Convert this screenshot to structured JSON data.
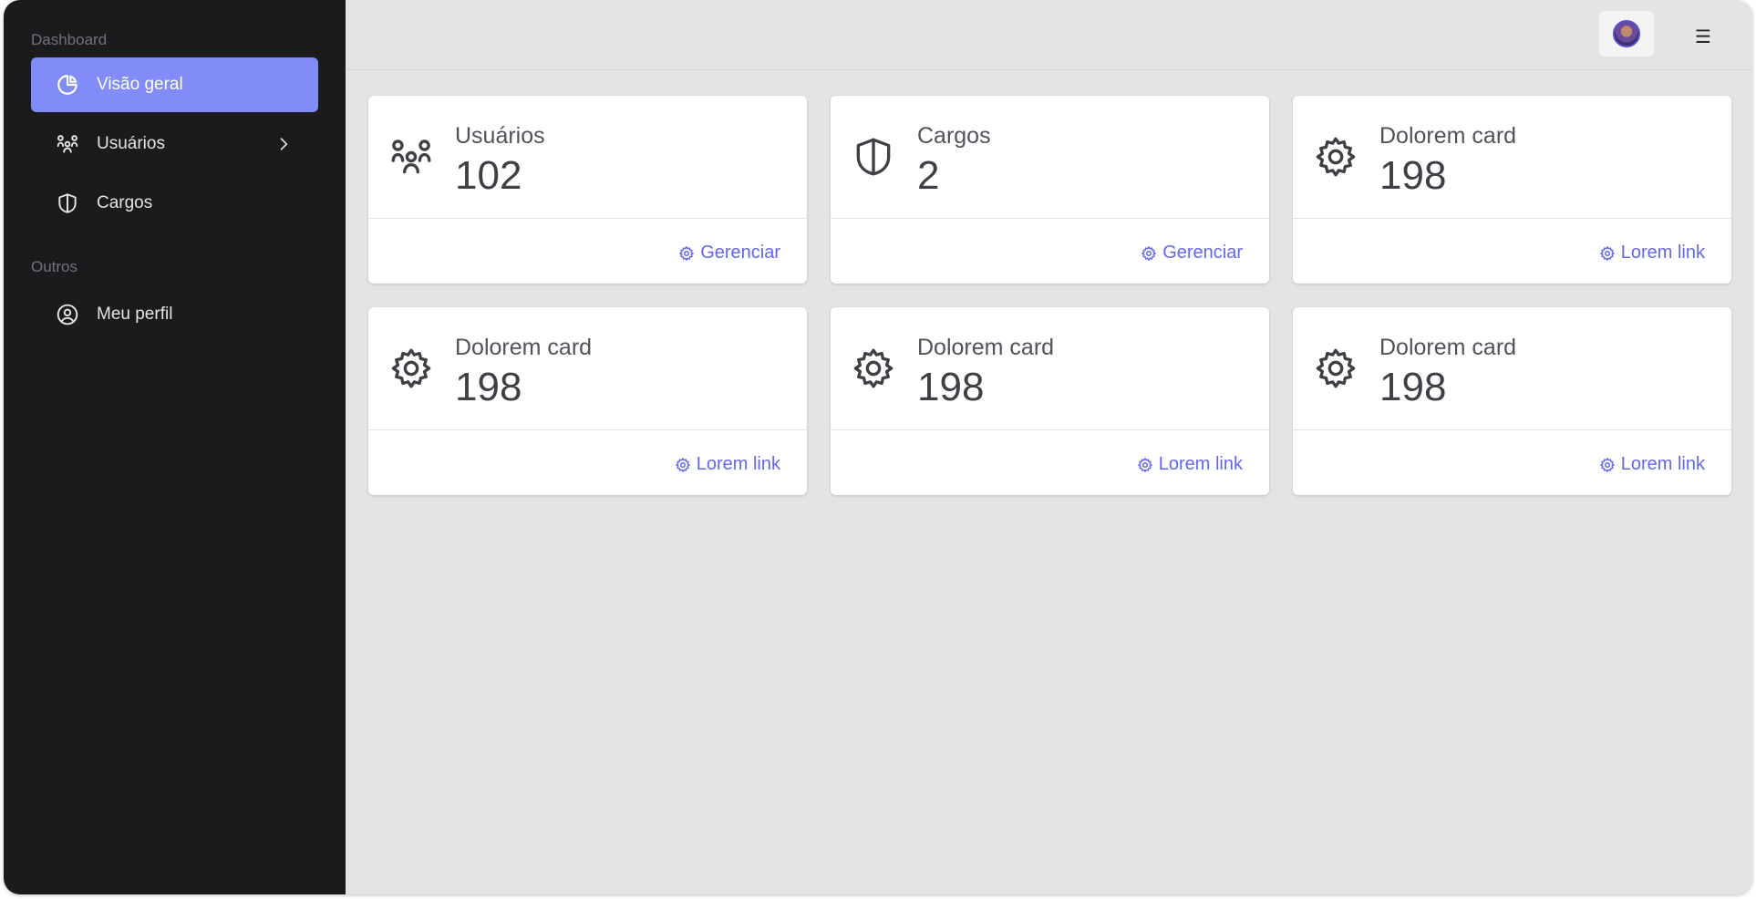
{
  "sidebar": {
    "sections": [
      {
        "label": "Dashboard",
        "items": [
          {
            "label": "Visão geral",
            "icon": "pie-chart-icon",
            "active": true
          },
          {
            "label": "Usuários",
            "icon": "users-icon",
            "has_submenu": true
          },
          {
            "label": "Cargos",
            "icon": "shield-icon"
          }
        ]
      },
      {
        "label": "Outros",
        "items": [
          {
            "label": "Meu perfil",
            "icon": "user-circle-icon"
          }
        ]
      }
    ]
  },
  "topbar": {
    "avatar_icon": "avatar",
    "menu_glyph": "☰"
  },
  "cards": [
    {
      "label": "Usuários",
      "value": "102",
      "icon": "users-icon",
      "link": "Gerenciar"
    },
    {
      "label": "Cargos",
      "value": "2",
      "icon": "shield-icon",
      "link": "Gerenciar"
    },
    {
      "label": "Dolorem card",
      "value": "198",
      "icon": "gear-icon",
      "link": "Lorem link"
    },
    {
      "label": "Dolorem card",
      "value": "198",
      "icon": "gear-icon",
      "link": "Lorem link"
    },
    {
      "label": "Dolorem card",
      "value": "198",
      "icon": "gear-icon",
      "link": "Lorem link"
    },
    {
      "label": "Dolorem card",
      "value": "198",
      "icon": "gear-icon",
      "link": "Lorem link"
    }
  ],
  "colors": {
    "sidebar_bg": "#1b1b1d",
    "accent": "#818cf8",
    "link": "#6366f1",
    "page_bg": "#e4e4e7"
  }
}
